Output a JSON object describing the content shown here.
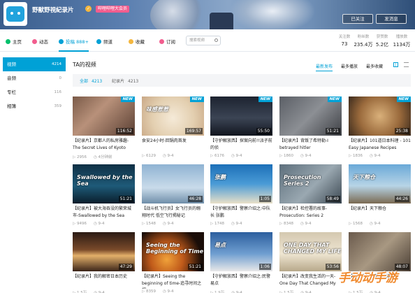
{
  "header": {
    "channel_name": "野獸野視紀录片",
    "verified_icon": "verified-icon",
    "badge": "哔哩哔哩大会员",
    "follow_button": "已关注",
    "message_button": "发消息"
  },
  "nav": {
    "items": [
      {
        "label": "主页",
        "icon": "home-icon",
        "color": "#00c06c"
      },
      {
        "label": "动态",
        "icon": "activity-icon",
        "color": "#f25d8e"
      },
      {
        "label": "投稿 888+",
        "icon": "video-icon",
        "color": "#00a1d6"
      },
      {
        "label": "频道",
        "icon": "channel-icon",
        "color": "#00a1d6"
      },
      {
        "label": "收藏",
        "icon": "star-icon",
        "color": "#f4b73f"
      },
      {
        "label": "订阅",
        "icon": "heart-icon",
        "color": "#f25d8e"
      }
    ],
    "search_placeholder": "搜索视频",
    "stats": [
      {
        "label": "关注数",
        "value": "73"
      },
      {
        "label": "粉丝数",
        "value": "235.4万"
      },
      {
        "label": "获赞数",
        "value": "5.2亿"
      },
      {
        "label": "播放数",
        "value": "1134万"
      }
    ]
  },
  "sidebar": {
    "items": [
      {
        "label": "视频",
        "count": "4214"
      },
      {
        "label": "音频",
        "count": "0"
      },
      {
        "label": "专栏",
        "count": "116"
      },
      {
        "label": "相簿",
        "count": "359"
      }
    ]
  },
  "main": {
    "title": "TA的视频",
    "sort": [
      "最新发布",
      "最多播放",
      "最多收藏"
    ],
    "filters": [
      {
        "label": "全部",
        "count": "4213"
      },
      {
        "label": "纪录片",
        "count": "4213"
      }
    ]
  },
  "videos": [
    {
      "title": "【纪录片】京都人的私房雅趣-The Secret Lives of Kyoto",
      "duration": "116:52",
      "plays": "2956",
      "date": "4分钟前",
      "is_new": true,
      "overlay": ""
    },
    {
      "title": "食安24小时-回锅肉首发",
      "duration": "169:57",
      "plays": "6129",
      "date": "9-4",
      "is_new": true,
      "overlay": "味感惹惹"
    },
    {
      "title": "【守护解放西】探案向前!!派子前的侦",
      "duration": "55:50",
      "plays": "6176",
      "date": "9-4",
      "is_new": true,
      "overlay": ""
    },
    {
      "title": "【纪录片】背叛了希特勒-I betrayed hitler",
      "duration": "51:21",
      "plays": "1860",
      "date": "9-4",
      "is_new": true,
      "overlay": ""
    },
    {
      "title": "【纪录片】101道日本料理 - 101 Easy Japanese Recipes",
      "duration": "25:38",
      "plays": "1836",
      "date": "9-4",
      "is_new": true,
      "overlay": ""
    },
    {
      "title": "【纪录片】被大海吞没的繁荣城市-Swallowed by the Sea",
      "duration": "51:21",
      "plays": "9496",
      "date": "9-4",
      "is_new": false,
      "overlay": "Swallowed by the Sea"
    },
    {
      "title": "【战斗机飞行员】女飞行员的翱翔时代 低空飞行揭秘记",
      "duration": "46:28",
      "plays": "1548",
      "date": "9-4",
      "is_new": false,
      "overlay": ""
    },
    {
      "title": "【守护解放西】警察介绍之:中队长 张鹏",
      "duration": "1:05",
      "plays": "1748",
      "date": "9-4",
      "is_new": false,
      "overlay": "张鹏"
    },
    {
      "title": "【纪录片】检控署的故事-Prosecution: Series 2",
      "duration": "58:49",
      "plays": "8348",
      "date": "9-4",
      "is_new": false,
      "overlay": "Prosecution Series 2"
    },
    {
      "title": "【纪录片】天下粮仓",
      "duration": "44:26",
      "plays": "1568",
      "date": "9-4",
      "is_new": false,
      "overlay": "天下粮仓"
    },
    {
      "title": "【纪录片】我的解密日本历史",
      "duration": "47:29",
      "plays": "1.5万",
      "date": "9-4",
      "is_new": false,
      "overlay": ""
    },
    {
      "title": "【纪录片】Seeing the beginning of time-追寻时间之初",
      "duration": "51:21",
      "plays": "8359",
      "date": "9-4",
      "is_new": false,
      "overlay": "Seeing the Beginning of Time"
    },
    {
      "title": "【守护解放西】警察介绍之:民警 易点",
      "duration": "1:06",
      "plays": "1.9万",
      "date": "9-4",
      "is_new": false,
      "overlay": "易点"
    },
    {
      "title": "【纪录片】改变我生活的一天-One Day That Changed My",
      "duration": "53:56",
      "plays": "1.5万",
      "date": "9-4",
      "is_new": false,
      "overlay": "ONE DAY THAT CHANGED MY LIFE"
    },
    {
      "title": "【纪录片】改变你生活的",
      "duration": "48:07",
      "plays": "1.5万",
      "date": "9-4",
      "is_new": false,
      "overlay": ""
    }
  ],
  "watermark": "手动动手游"
}
